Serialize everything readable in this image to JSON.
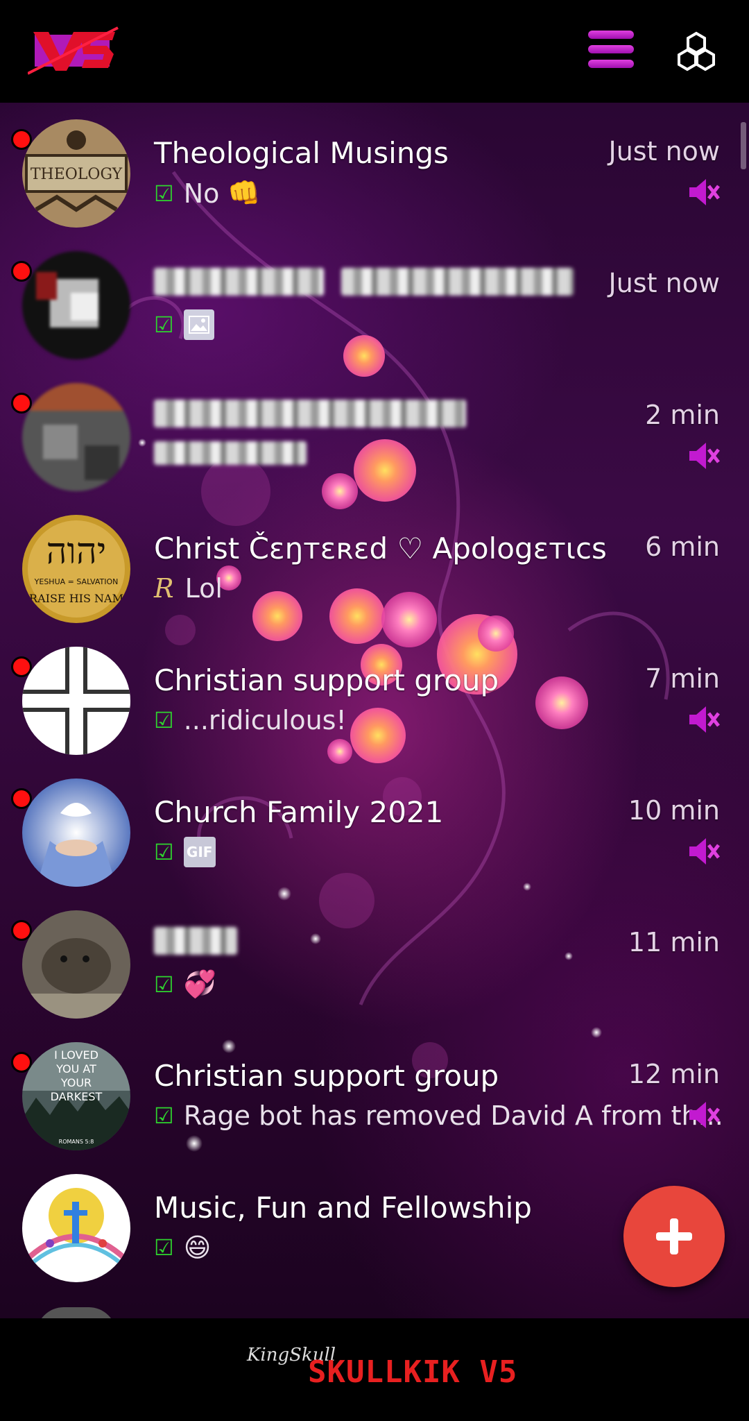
{
  "header": {
    "logo_text": "V5",
    "menu_icon": "hamburger-menu-icon",
    "settings_icon": "hexagon-cluster-icon"
  },
  "chats": [
    {
      "title": "Theological Musings",
      "time": "Just now",
      "message": "No",
      "message_emoji": "👊",
      "unread": true,
      "muted": true,
      "sent": true,
      "title_blurred": false
    },
    {
      "title": "",
      "time": "Just now",
      "message": "",
      "attachment": "image",
      "unread": true,
      "muted": false,
      "sent": true,
      "title_blurred": true
    },
    {
      "title": "",
      "time": "2 min",
      "message": "",
      "unread": true,
      "muted": true,
      "sent": true,
      "title_blurred": true
    },
    {
      "title": "Christ Čɛŋтɛʀɛd ♡ Apologɛтιcs",
      "time": "6 min",
      "message": "Lol",
      "sender_icon": "R",
      "unread": false,
      "muted": false,
      "sent": false,
      "title_blurred": false
    },
    {
      "title": "Christian support group",
      "time": "7 min",
      "message": "...ridiculous!",
      "unread": true,
      "muted": true,
      "sent": true,
      "title_blurred": false
    },
    {
      "title": "Church Family 2021",
      "time": "10 min",
      "message": "",
      "attachment": "GIF",
      "unread": true,
      "muted": true,
      "sent": true,
      "title_blurred": false
    },
    {
      "title": "",
      "time": "11 min",
      "message": "💞",
      "unread": true,
      "muted": false,
      "sent": true,
      "title_blurred": true
    },
    {
      "title": "Christian support group",
      "time": "12 min",
      "message": "Rage bot has removed David A from th...",
      "unread": true,
      "muted": true,
      "sent": true,
      "title_blurred": false
    },
    {
      "title": "Music, Fun and Fellowship",
      "time": "",
      "message": "😄",
      "unread": false,
      "muted": false,
      "sent": true,
      "title_blurred": false
    }
  ],
  "avatar_labels": {
    "theology": "THEOLOGY",
    "yhwh": "יהוה",
    "yeshua": "YESHUA = SALVATION",
    "praise": "RAISE HIS NAM",
    "loved_1": "I LOVED",
    "loved_2": "YOU AT",
    "loved_3": "YOUR",
    "loved_4": "DARKEST",
    "romans": "ROMANS 5:8"
  },
  "fab_label": "+",
  "footer": {
    "signature": "KingSkull",
    "brand": "SKULLKIK V5"
  },
  "colors": {
    "accent_magenta": "#c21ad0",
    "unread_dot": "#ff1010",
    "check_green": "#2ed52e",
    "fab_red": "#e8463c",
    "brand_red": "#e82020"
  }
}
